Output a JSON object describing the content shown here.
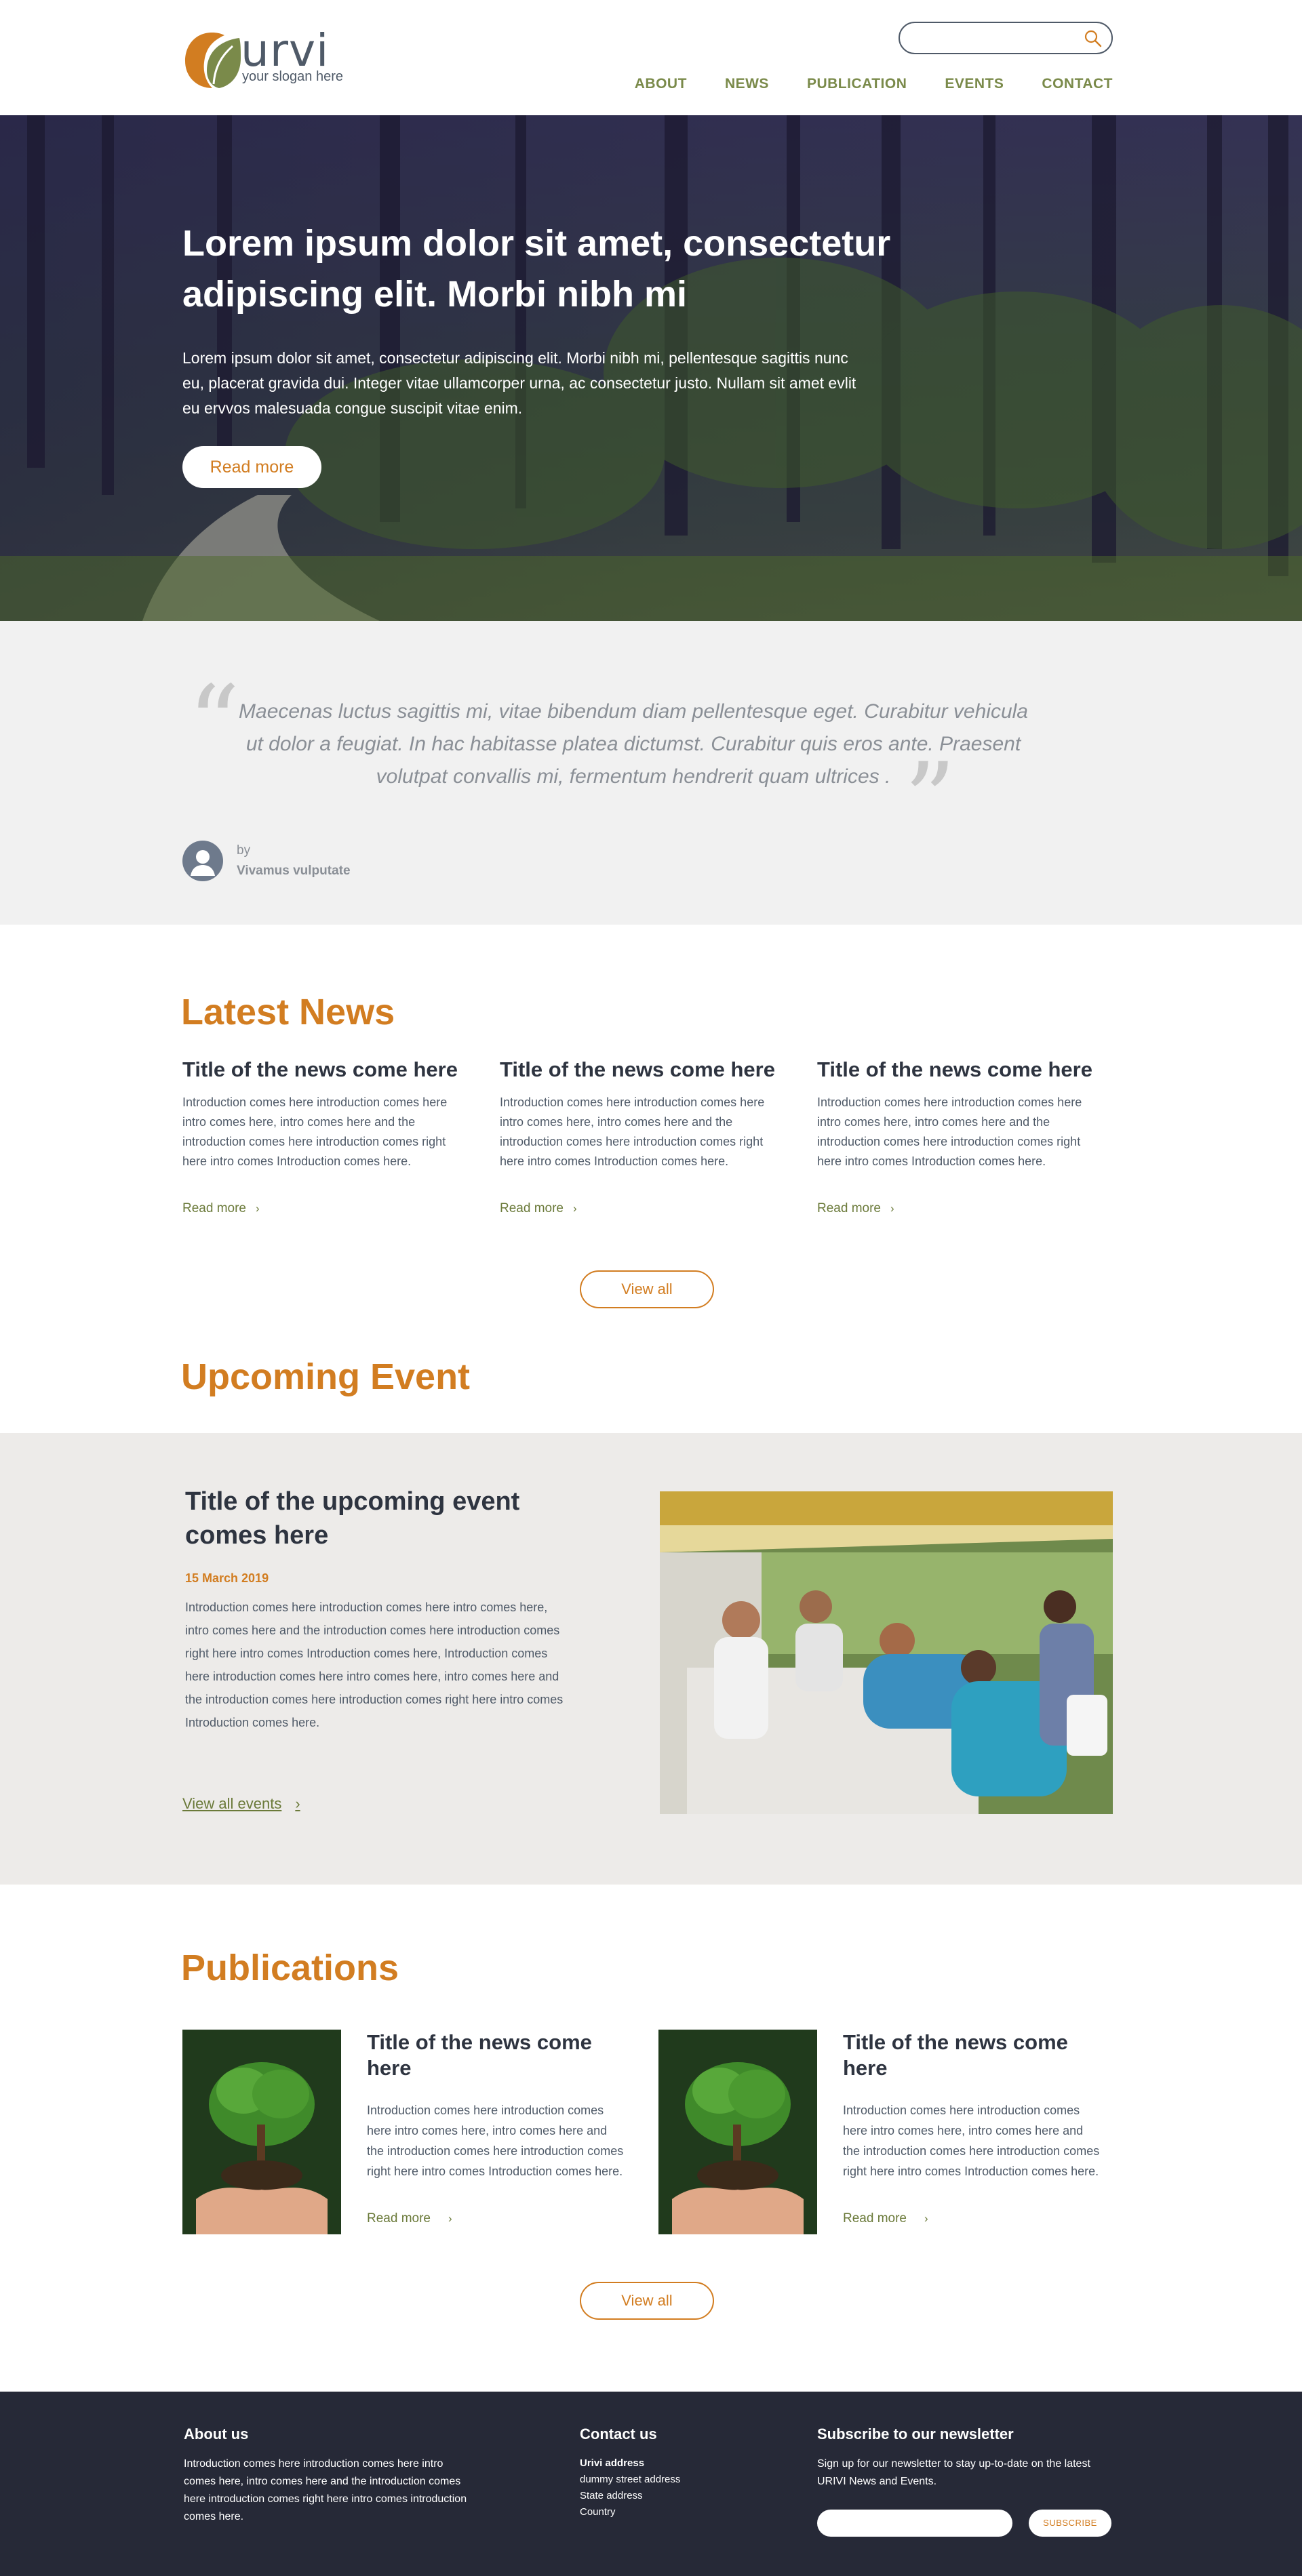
{
  "brand": {
    "name": "urvi",
    "slogan": "your slogan here",
    "accent_color": "#d27d21",
    "nav_color": "#7a8a4a"
  },
  "search": {
    "placeholder": ""
  },
  "nav": [
    "ABOUT",
    "NEWS",
    "PUBLICATION",
    "EVENTS",
    "CONTACT"
  ],
  "hero": {
    "title": "Lorem ipsum dolor sit amet, consectetur adipiscing elit. Morbi nibh mi",
    "text": "Lorem ipsum dolor sit amet, consectetur adipiscing elit. Morbi nibh mi, pellentesque sagittis nunc eu, placerat gravida dui. Integer vitae ullamcorper urna, ac consectetur justo. Nullam sit amet evlit eu ervvos malesuada congue suscipit vitae enim.",
    "button": "Read more"
  },
  "quote": {
    "text": "Maecenas luctus sagittis mi, vitae bibendum diam pellentesque eget. Curabitur vehicula ut dolor a feugiat. In hac habitasse platea dictumst. Curabitur quis eros ante. Praesent volutpat convallis mi, fermentum hendrerit quam ultrices .",
    "by": "by",
    "author": "Vivamus vulputate"
  },
  "news": {
    "title": "Latest News",
    "items": [
      {
        "title": "Title of the news come here",
        "text": "Introduction comes here introduction comes here intro comes here, intro comes here and the introduction comes here introduction comes right here intro comes Introduction comes here.",
        "link": "Read more"
      },
      {
        "title": "Title of the news come here",
        "text": "Introduction comes here introduction comes here intro comes here, intro comes here and the introduction comes here introduction comes right here intro comes Introduction comes here.",
        "link": "Read more"
      },
      {
        "title": "Title of the news come here",
        "text": "Introduction comes here introduction comes here intro comes here, intro comes here and the introduction comes here introduction comes right here intro comes Introduction comes here.",
        "link": "Read more"
      }
    ],
    "view_all": "View all"
  },
  "event": {
    "section_title": "Upcoming Event",
    "title": "Title of the upcoming event comes here",
    "date": "15 March 2019",
    "text": "Introduction comes here introduction comes here intro comes here, intro comes here and the introduction comes here introduction comes right here intro comes Introduction comes here, Introduction comes here introduction comes here intro comes here, intro comes here and the introduction comes here introduction comes right here intro comes Introduction comes here.",
    "link": "View all events"
  },
  "publications": {
    "title": "Publications",
    "items": [
      {
        "title": "Title of the news come here",
        "text": "Introduction comes here introduction comes here intro comes here, intro comes here and the introduction comes here introduction comes right here intro comes Introduction comes here.",
        "link": "Read more"
      },
      {
        "title": "Title of the news come here",
        "text": "Introduction comes here introduction comes here intro comes here, intro comes here and the introduction comes here introduction comes right here intro comes Introduction comes here.",
        "link": "Read more"
      }
    ],
    "view_all": "View all"
  },
  "footer": {
    "about_title": "About us",
    "about_text": "Introduction comes here introduction comes here intro comes here, intro comes here and the introduction comes here introduction comes right here intro comes introduction comes here.",
    "contact_title": "Contact us",
    "contact_lines": [
      "Urivi  address",
      "dummy street address",
      "State address",
      "Country"
    ],
    "newsletter_title": "Subscribe to our newsletter",
    "newsletter_text": "Sign up for our newsletter to stay up-to-date on the latest URIVI News and Events.",
    "subscribe_button": "SUBSCRIBE"
  }
}
